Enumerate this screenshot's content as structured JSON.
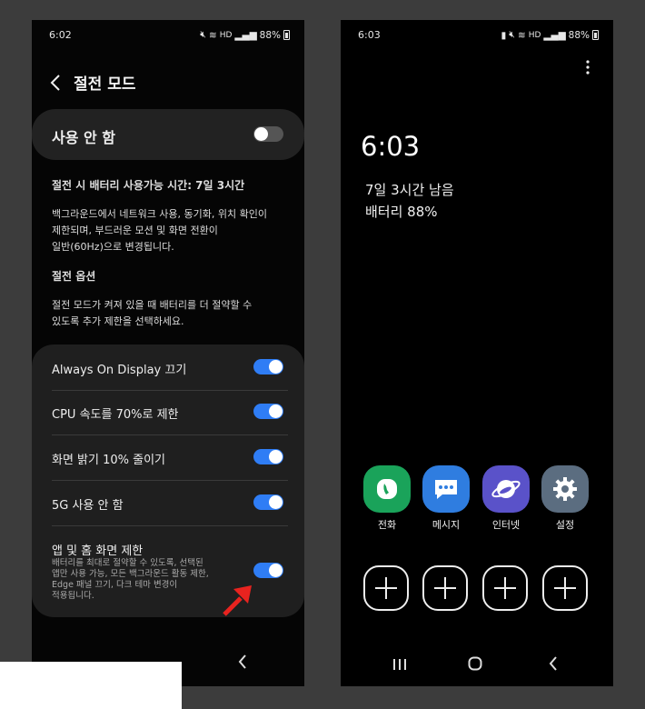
{
  "left": {
    "status_time": "6:02",
    "battery": "88%",
    "network": "HD",
    "title": "절전 모드",
    "master_label": "사용 안 함",
    "estimate": "절전 시 배터리 사용가능 시간: 7일 3시간",
    "description": [
      "백그라운드에서 네트워크 사용, 동기화, 위치 확인이",
      "제한되며, 부드러운 모션 및 화면 전환이",
      "일반(60Hz)으로 변경됩니다."
    ],
    "options_title": "절전 옵션",
    "options_description": [
      "절전 모드가 켜져 있을 때 배터리를 더 절약할 수",
      "있도록 추가 제한을 선택하세요."
    ],
    "options": [
      {
        "label": "Always On Display 끄기",
        "on": true
      },
      {
        "label": "CPU 속도를 70%로 제한",
        "on": true
      },
      {
        "label": "화면 밝기 10% 줄이기",
        "on": true
      },
      {
        "label": "5G 사용 안 함",
        "on": true
      },
      {
        "label": "앱 및 홈 화면 제한",
        "on": true,
        "sub": [
          "배터리를 최대로 절약할 수 있도록, 선택된",
          "앱만 사용 가능, 모든 백그라운드 활동 제한,",
          "Edge 패널 끄기, 다크 테마 변경이",
          "적용됩니다."
        ]
      }
    ]
  },
  "right": {
    "status_time": "6:03",
    "battery": "88%",
    "network": "HD",
    "clock": "6:03",
    "remaining": "7일 3시간 남음",
    "battery_line": "배터리 88%",
    "apps": [
      {
        "name": "전화",
        "icon": "phone-icon",
        "color": "#1aa35a"
      },
      {
        "name": "메시지",
        "icon": "message-icon",
        "color": "#2f7de0"
      },
      {
        "name": "인터넷",
        "icon": "internet-icon",
        "color": "#5a52c9"
      },
      {
        "name": "설정",
        "icon": "gear-icon",
        "color": "#5b6d80"
      }
    ]
  }
}
